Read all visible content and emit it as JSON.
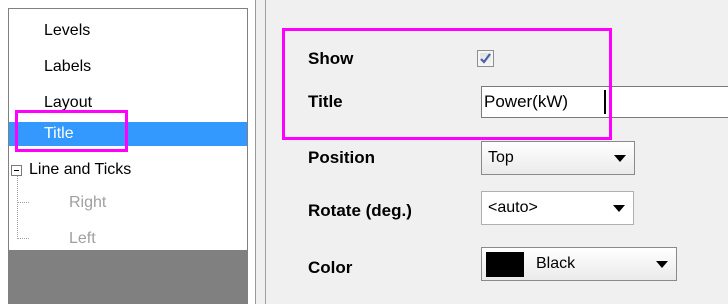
{
  "tree": {
    "items": [
      {
        "label": "Levels"
      },
      {
        "label": "Labels"
      },
      {
        "label": "Layout"
      },
      {
        "label": "Title",
        "selected": true
      },
      {
        "label": "Line and Ticks",
        "expanded": true
      },
      {
        "label": "Right",
        "disabled": true
      },
      {
        "label": "Left",
        "disabled": true
      }
    ]
  },
  "properties": {
    "show": {
      "label": "Show",
      "checked": true
    },
    "title": {
      "label": "Title",
      "value": "Power(kW)"
    },
    "position": {
      "label": "Position",
      "value": "Top"
    },
    "rotate": {
      "label": "Rotate (deg.)",
      "value": "<auto>"
    },
    "color": {
      "label": "Color",
      "value": "Black",
      "swatch": "#000000"
    }
  },
  "colors": {
    "highlight": "#ff00ff",
    "selection": "#3399ff",
    "panel": "#f0f0f0"
  }
}
